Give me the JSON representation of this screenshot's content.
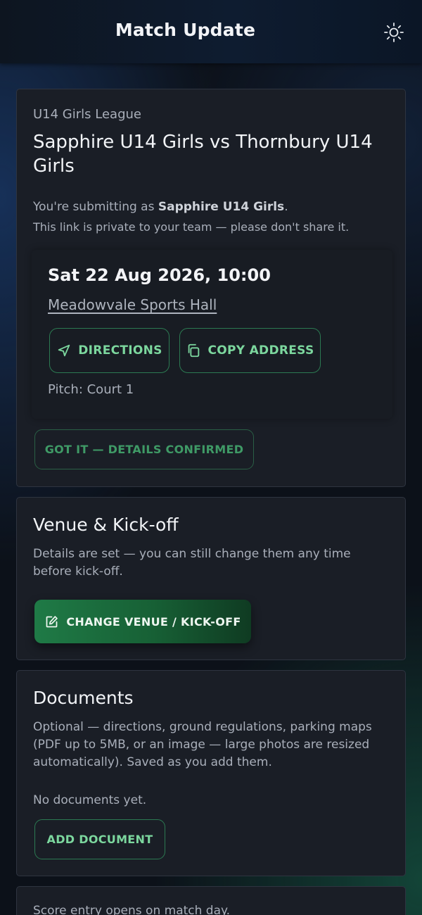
{
  "header": {
    "title": "Match Update",
    "theme_toggle_icon": "sun-icon"
  },
  "match": {
    "league": "U14 Girls League",
    "title": "Sapphire U14 Girls vs Thornbury U14 Girls",
    "submitting_prefix": "You're submitting as ",
    "team_name": "Sapphire U14 Girls",
    "submitting_suffix": ".",
    "private_note": "This link is private to your team — please don't share it.",
    "datetime": "Sat 22 Aug 2026, 10:00",
    "venue": "Meadowvale Sports Hall",
    "directions_label": "DIRECTIONS",
    "copy_address_label": "COPY ADDRESS",
    "pitch": "Pitch: Court 1",
    "confirm_label": "GOT IT — DETAILS CONFIRMED"
  },
  "venue_section": {
    "title": "Venue & Kick-off",
    "description": "Details are set — you can still change them any time before kick-off.",
    "change_label": "CHANGE VENUE / KICK-OFF"
  },
  "documents": {
    "title": "Documents",
    "description": "Optional — directions, ground regulations, parking maps (PDF up to 5MB, or an image — large photos are resized automatically). Saved as you add them.",
    "empty_text": "No documents yet.",
    "add_label": "ADD DOCUMENT"
  },
  "score": {
    "text": "Score entry opens on match day."
  },
  "colors": {
    "accent_green": "#7cd79e",
    "border_green": "#2c7a52",
    "card_bg": "#1a1e26",
    "page_bg": "#0c1119"
  }
}
